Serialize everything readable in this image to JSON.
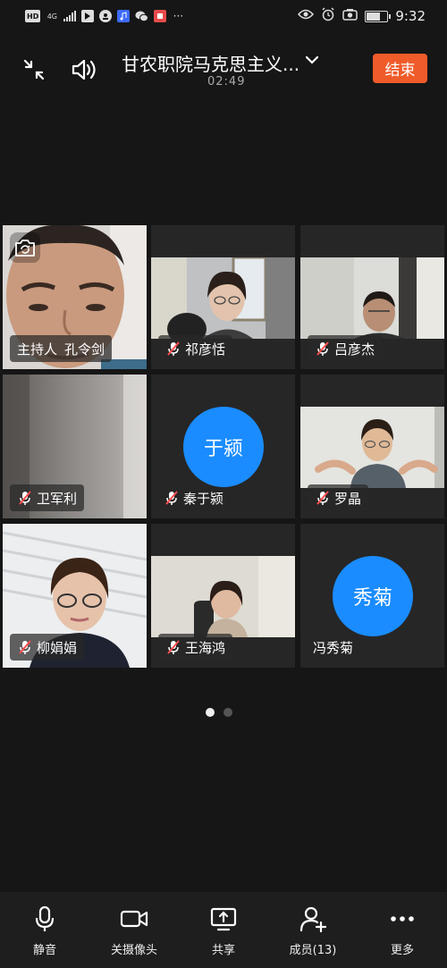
{
  "status_bar": {
    "left_icons": [
      {
        "name": "hd-icon",
        "text": "HD"
      },
      {
        "name": "network-4g-icon",
        "text": "4G"
      },
      {
        "name": "signal-icon"
      },
      {
        "name": "tiktok-icon"
      },
      {
        "name": "app-icon"
      },
      {
        "name": "music-app-icon"
      },
      {
        "name": "wechat-icon"
      },
      {
        "name": "red-app-icon"
      },
      {
        "name": "more-notifications-icon",
        "text": "···"
      }
    ],
    "battery_level": 0.72,
    "time": "9:32"
  },
  "meeting": {
    "title": "甘农职院马克思主义...",
    "elapsed": "02:49",
    "end_label": "结束"
  },
  "participants": [
    {
      "name": "孔令剑",
      "host_label": "主持人",
      "muted": false,
      "video": "host",
      "has_camera_switch": true
    },
    {
      "name": "祁彦恬",
      "muted": true,
      "video": "room"
    },
    {
      "name": "吕彦杰",
      "muted": true,
      "video": "office"
    },
    {
      "name": "卫军利",
      "muted": true,
      "video": "blurred"
    },
    {
      "name": "秦于颍",
      "muted": true,
      "video": "none",
      "avatar_text": "于颍"
    },
    {
      "name": "罗晶",
      "muted": true,
      "video": "wall"
    },
    {
      "name": "柳娟娟",
      "muted": true,
      "video": "ceiling"
    },
    {
      "name": "王海鸿",
      "muted": true,
      "video": "chair"
    },
    {
      "name": "冯秀菊",
      "muted": false,
      "video": "none",
      "avatar_text": "秀菊"
    }
  ],
  "pager": {
    "pages": 2,
    "current": 1
  },
  "toolbar": {
    "mute_label": "静音",
    "camera_label": "关摄像头",
    "share_label": "共享",
    "members_label": "成员(13)",
    "more_label": "更多"
  },
  "colors": {
    "background": "#161616",
    "end_button": "#f05b2a",
    "avatar": "#1a8cff",
    "mic_off_red": "#ff4d4d"
  }
}
